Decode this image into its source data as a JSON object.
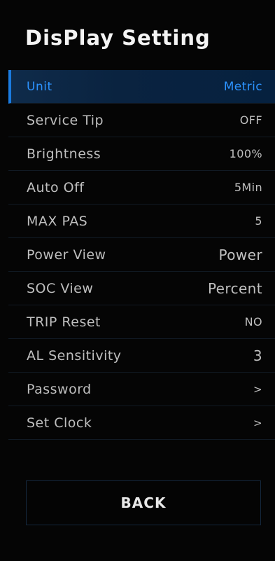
{
  "title": "DisPlay Setting",
  "menu": [
    {
      "label": "Unit",
      "value": "Metric"
    },
    {
      "label": "Service Tip",
      "value": "OFF"
    },
    {
      "label": "Brightness",
      "value": "100%"
    },
    {
      "label": "Auto Off",
      "value": "5Min"
    },
    {
      "label": "MAX PAS",
      "value": "5"
    },
    {
      "label": "Power View",
      "value": "Power"
    },
    {
      "label": "SOC View",
      "value": "Percent"
    },
    {
      "label": "TRIP Reset",
      "value": "NO"
    },
    {
      "label": "AL Sensitivity",
      "value": "3"
    },
    {
      "label": "Password",
      "value": ">"
    },
    {
      "label": "Set Clock",
      "value": ">"
    }
  ],
  "back_label": "BACK",
  "colors": {
    "accent": "#2C93FF",
    "selected_bg": "#0A2340",
    "text": "#BFBFBF",
    "background": "#050505"
  }
}
